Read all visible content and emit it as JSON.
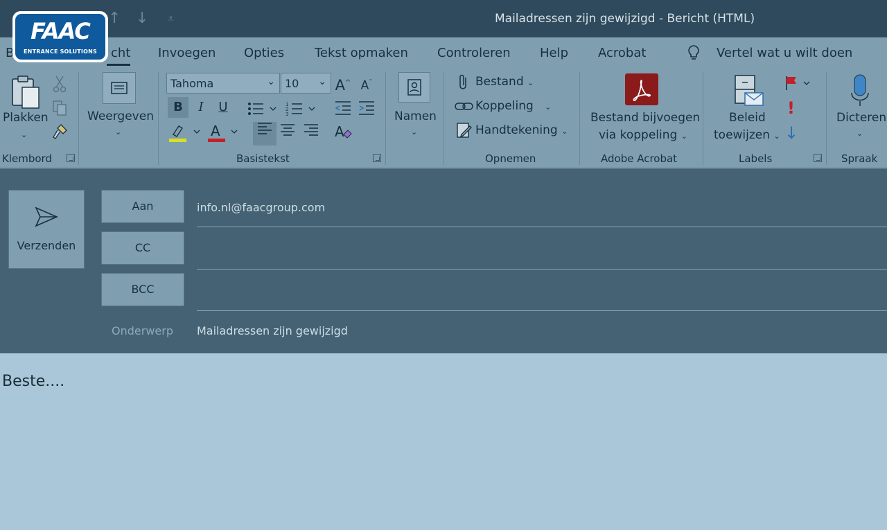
{
  "window": {
    "title": "Mailadressen zijn gewijzigd  -  Bericht (HTML)"
  },
  "logo": {
    "brand": "FAAC",
    "tagline": "ENTRANCE SOLUTIONS"
  },
  "tabs": [
    {
      "label": "Bericht",
      "visible_text": "cht",
      "active": true
    },
    {
      "label": "Invoegen"
    },
    {
      "label": "Opties"
    },
    {
      "label": "Tekst opmaken"
    },
    {
      "label": "Controleren"
    },
    {
      "label": "Help"
    },
    {
      "label": "Acrobat"
    }
  ],
  "tell_me": "Vertel wat u wilt doen",
  "tab_b": "B",
  "ribbon": {
    "clipboard": {
      "paste": "Plakken",
      "group": "Klembord"
    },
    "view": {
      "label": "Weergeven"
    },
    "basic_text": {
      "font": "Tahoma",
      "size": "10",
      "grow": "A",
      "shrink": "A",
      "bold": "B",
      "italic": "I",
      "underline": "U",
      "font_color": "A",
      "group": "Basistekst"
    },
    "names": {
      "label": "Namen"
    },
    "include": {
      "file": "Bestand",
      "link": "Koppeling",
      "signature": "Handtekening",
      "group": "Opnemen"
    },
    "acrobat": {
      "line1": "Bestand bijvoegen",
      "line2": "via koppeling",
      "group": "Adobe Acrobat"
    },
    "labels": {
      "line1": "Beleid",
      "line2": "toewijzen",
      "group": "Labels"
    },
    "speech": {
      "label": "Dicteren",
      "group": "Spraak"
    }
  },
  "compose": {
    "send": "Verzenden",
    "to_label": "Aan",
    "to_value": "info.nl@faacgroup.com",
    "cc_label": "CC",
    "bcc_label": "BCC",
    "subject_label": "Onderwerp",
    "subject_value": "Mailadressen zijn gewijzigd"
  },
  "body": {
    "text": "Beste...."
  },
  "colors": {
    "titlebar": "#2e4a5c",
    "ribbon": "#7f9fb1",
    "compose": "#446273",
    "body": "#a9c7d9",
    "logo_blue": "#0f5a9c",
    "acrobat_red": "#8b1a1a"
  }
}
